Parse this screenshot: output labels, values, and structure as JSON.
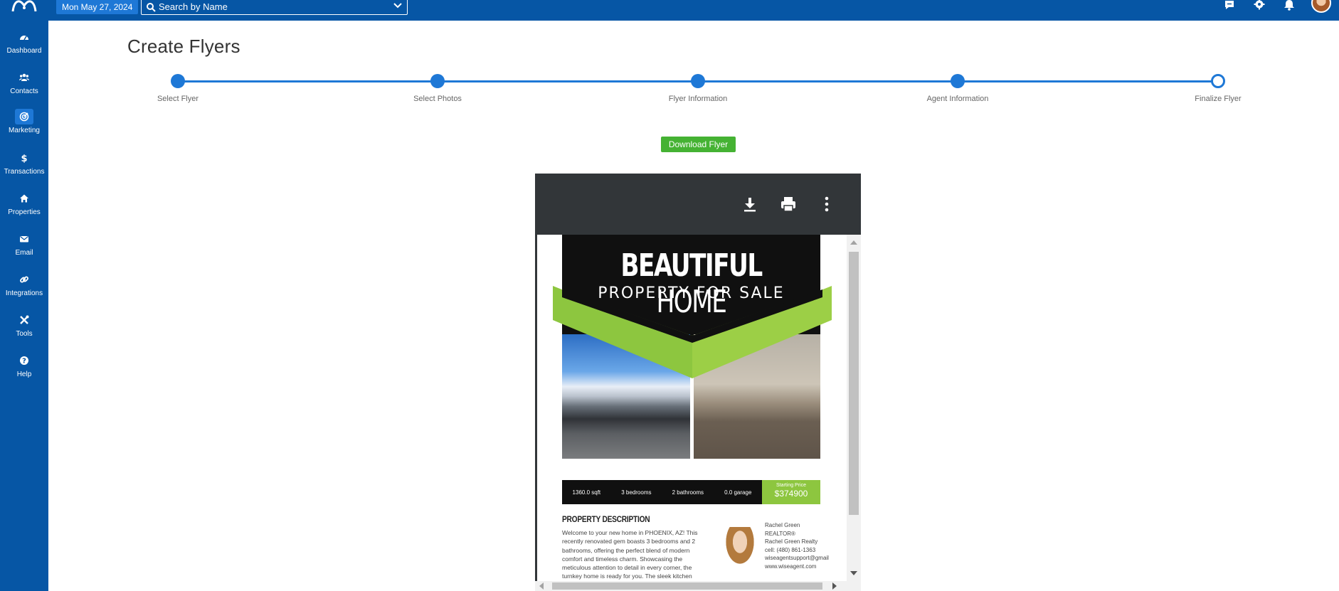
{
  "topbar": {
    "date": "Mon May 27, 2024",
    "search_placeholder": "Search by Name"
  },
  "sidebar": {
    "items": [
      {
        "label": "Dashboard",
        "icon": "dashboard-icon"
      },
      {
        "label": "Contacts",
        "icon": "contacts-icon"
      },
      {
        "label": "Marketing",
        "icon": "marketing-icon",
        "active": true
      },
      {
        "label": "Transactions",
        "icon": "dollar-icon"
      },
      {
        "label": "Properties",
        "icon": "home-icon"
      },
      {
        "label": "Email",
        "icon": "envelope-icon"
      },
      {
        "label": "Integrations",
        "icon": "link-icon"
      },
      {
        "label": "Tools",
        "icon": "tools-icon"
      },
      {
        "label": "Help",
        "icon": "help-icon"
      }
    ]
  },
  "page": {
    "title": "Create Flyers",
    "download_label": "Download Flyer"
  },
  "steps": [
    {
      "label": "Select Flyer",
      "done": true
    },
    {
      "label": "Select Photos",
      "done": true
    },
    {
      "label": "Flyer Information",
      "done": true
    },
    {
      "label": "Agent Information",
      "done": true
    },
    {
      "label": "Finalize Flyer",
      "done": false
    }
  ],
  "flyer": {
    "headline_bold": "BEAUTIFUL",
    "headline_thin": "HOME",
    "subhead": "PROPERTY FOR SALE",
    "stats": {
      "sqft": "1360.0 sqft",
      "bedrooms": "3 bedrooms",
      "bathrooms": "2 bathrooms",
      "garage": "0.0 garage"
    },
    "price_label": "Starting Price",
    "price": "$374900",
    "description_title": "PROPERTY DESCRIPTION",
    "description": "Welcome to your new home in PHOENIX, AZ! This recently renovated gem boasts 3 bedrooms and 2 bathrooms, offering the perfect blend of modern comfort and timeless charm. Showcasing the meticulous attention to detail in every corner, the turnkey home is ready for you. The sleek kitchen",
    "agent": {
      "name": "Rachel Green",
      "title": "REALTOR®",
      "company": "Rachel Green Realty",
      "cell": "cell: (480) 861-1363",
      "email": "wiseagentsupport@gmail",
      "website": "www.wiseagent.com"
    }
  },
  "colors": {
    "brand_blue": "#0656a5",
    "accent_blue": "#1e78d6",
    "download_green": "#45b233",
    "flyer_green": "#8dc63f"
  }
}
